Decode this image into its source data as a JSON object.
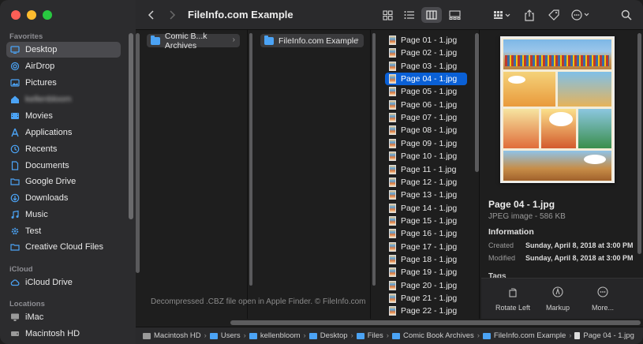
{
  "window": {
    "title": "FileInfo.com Example"
  },
  "sidebar": {
    "favorites_label": "Favorites",
    "icloud_label": "iCloud",
    "locations_label": "Locations",
    "favorites": [
      {
        "label": "Desktop",
        "icon": "desktop-icon"
      },
      {
        "label": "AirDrop",
        "icon": "airdrop-icon"
      },
      {
        "label": "Pictures",
        "icon": "pictures-icon"
      },
      {
        "label": "kellenbloom",
        "icon": "home-icon"
      },
      {
        "label": "Movies",
        "icon": "movies-icon"
      },
      {
        "label": "Applications",
        "icon": "applications-icon"
      },
      {
        "label": "Recents",
        "icon": "recents-icon"
      },
      {
        "label": "Documents",
        "icon": "documents-icon"
      },
      {
        "label": "Google Drive",
        "icon": "folder-icon"
      },
      {
        "label": "Downloads",
        "icon": "downloads-icon"
      },
      {
        "label": "Music",
        "icon": "music-icon"
      },
      {
        "label": "Test",
        "icon": "gear-icon"
      },
      {
        "label": "Creative Cloud Files",
        "icon": "folder-icon"
      }
    ],
    "icloud": [
      {
        "label": "iCloud Drive",
        "icon": "cloud-icon"
      }
    ],
    "locations": [
      {
        "label": "iMac",
        "icon": "computer-icon"
      },
      {
        "label": "Macintosh HD",
        "icon": "disk-icon"
      }
    ]
  },
  "columns": {
    "col1_item": "Comic B...k Archives",
    "col2_item": "FileInfo.com Example",
    "files": [
      "Page 01 - 1.jpg",
      "Page 02 - 1.jpg",
      "Page 03 - 1.jpg",
      "Page 04 - 1.jpg",
      "Page 05 - 1.jpg",
      "Page 06 - 1.jpg",
      "Page 07 - 1.jpg",
      "Page 08 - 1.jpg",
      "Page 09 - 1.jpg",
      "Page 10 - 1.jpg",
      "Page 11 - 1.jpg",
      "Page 12 - 1.jpg",
      "Page 13 - 1.jpg",
      "Page 14 - 1.jpg",
      "Page 15 - 1.jpg",
      "Page 16 - 1.jpg",
      "Page 17 - 1.jpg",
      "Page 18 - 1.jpg",
      "Page 19 - 1.jpg",
      "Page 20 - 1.jpg",
      "Page 21 - 1.jpg",
      "Page 22 - 1.jpg"
    ],
    "selected_file_index": 3
  },
  "watermark": "Decompressed .CBZ file open in Apple Finder. © FileInfo.com",
  "preview": {
    "name": "Page 04 - 1.jpg",
    "kind": "JPEG image - 586 KB",
    "info_label": "Information",
    "created_label": "Created",
    "created_value": "Sunday, April 8, 2018 at 3:00 PM",
    "modified_label": "Modified",
    "modified_value": "Sunday, April 8, 2018 at 3:00 PM",
    "tags_label": "Tags",
    "actions": [
      {
        "label": "Rotate Left",
        "icon": "rotate-left-icon"
      },
      {
        "label": "Markup",
        "icon": "markup-icon"
      },
      {
        "label": "More...",
        "icon": "more-icon"
      }
    ]
  },
  "pathbar": [
    {
      "label": "Macintosh HD",
      "icon": "disk-icon"
    },
    {
      "label": "Users",
      "icon": "folder-icon"
    },
    {
      "label": "kellenbloom",
      "icon": "folder-icon"
    },
    {
      "label": "Desktop",
      "icon": "folder-icon"
    },
    {
      "label": "Files",
      "icon": "folder-icon"
    },
    {
      "label": "Comic Book Archives",
      "icon": "folder-icon"
    },
    {
      "label": "FileInfo.com Example",
      "icon": "folder-icon"
    },
    {
      "label": "Page 04 - 1.jpg",
      "icon": "file-icon"
    }
  ]
}
